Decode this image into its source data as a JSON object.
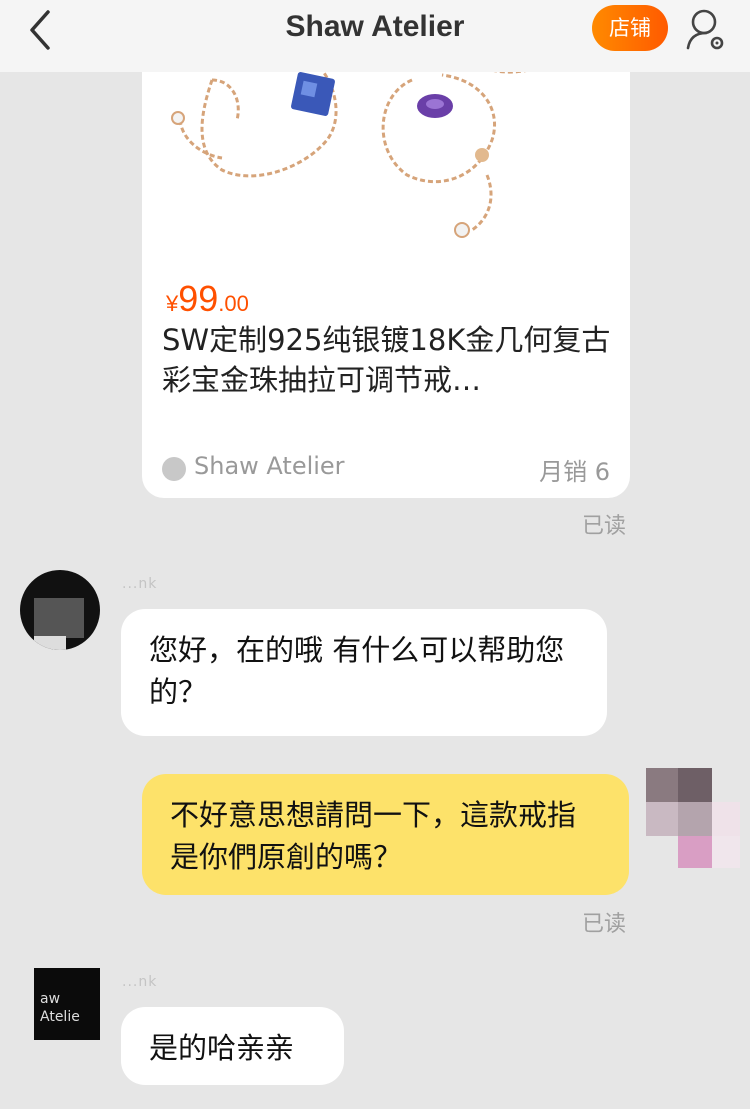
{
  "header": {
    "title": "Shaw Atelier",
    "shop_button": "店铺"
  },
  "product_card": {
    "currency": "¥",
    "price_int": "99",
    "price_dec": ".00",
    "title": "SW定制925纯银镀18K金几何复古彩宝金珠抽拉可调节戒…",
    "shop_name": "Shaw Atelier",
    "sales": "月销 6"
  },
  "messages": [
    {
      "sender": "other",
      "name": "...nk",
      "text": "您好，在的哦 有什么可以帮助您的？"
    },
    {
      "sender": "me",
      "text": "不好意思想請問一下，這款戒指是你們原創的嗎？",
      "status": "已读"
    },
    {
      "sender": "other",
      "name": "...nk",
      "avatar_text": "aw\nAtelie",
      "text": "是的哈亲亲"
    }
  ],
  "card_status": "已读",
  "colors": {
    "accent": "#ff5000",
    "my_bubble": "#fde26a",
    "background": "#e6e6e6"
  }
}
